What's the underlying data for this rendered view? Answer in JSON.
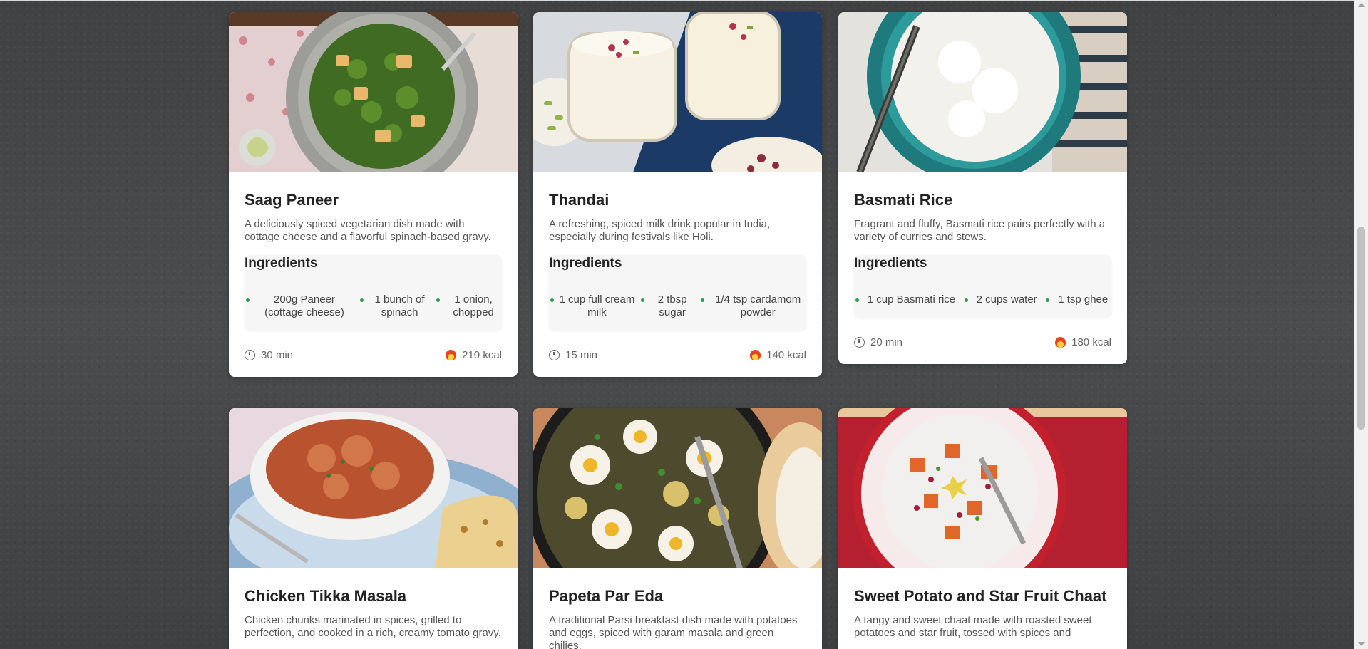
{
  "ingredients_heading": "Ingredients",
  "cards": [
    {
      "title": "Saag Paneer",
      "description": "A deliciously spiced vegetarian dish made with cottage cheese and a flavorful spinach-based gravy.",
      "ingredients": [
        "200g Paneer (cottage cheese)",
        "1 bunch of spinach",
        "1 onion, chopped"
      ],
      "time": "30 min",
      "calories": "210 kcal",
      "image_icon": "saag-paneer-photo"
    },
    {
      "title": "Thandai",
      "description": "A refreshing, spiced milk drink popular in India, especially during festivals like Holi.",
      "ingredients": [
        "1 cup full cream milk",
        "2 tbsp sugar",
        "1/4 tsp cardamom powder"
      ],
      "time": "15 min",
      "calories": "140 kcal",
      "image_icon": "thandai-photo"
    },
    {
      "title": "Basmati Rice",
      "description": "Fragrant and fluffy, Basmati rice pairs perfectly with a variety of curries and stews.",
      "ingredients": [
        "1 cup Basmati rice",
        "2 cups water",
        "1 tsp ghee"
      ],
      "time": "20 min",
      "calories": "180 kcal",
      "image_icon": "basmati-rice-photo"
    },
    {
      "title": "Chicken Tikka Masala",
      "description": "Chicken chunks marinated in spices, grilled to perfection, and cooked in a rich, creamy tomato gravy.",
      "image_icon": "chicken-tikka-masala-photo"
    },
    {
      "title": "Papeta Par Eda",
      "description": "A traditional Parsi breakfast dish made with potatoes and eggs, spiced with garam masala and green chilies.",
      "image_icon": "papeta-par-eda-photo"
    },
    {
      "title": "Sweet Potato and Star Fruit Chaat",
      "description": "A tangy and sweet chaat made with roasted sweet potatoes and star fruit, tossed with spices and",
      "image_icon": "sweet-potato-chaat-photo"
    }
  ],
  "colors": {
    "bullet": "#2e9b4e",
    "background": "#46484a"
  }
}
